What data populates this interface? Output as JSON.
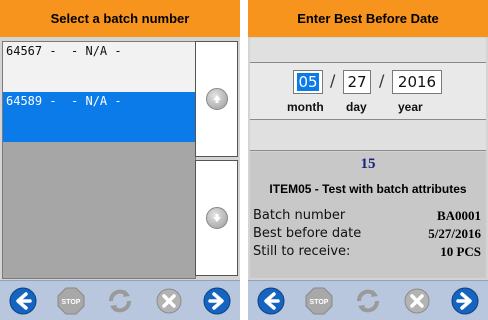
{
  "left_screen": {
    "title": "Select a batch number",
    "batches": [
      {
        "label": "64567 -  - N/A -",
        "selected": false
      },
      {
        "label": "64589 -  - N/A -",
        "selected": true
      }
    ],
    "scroll_up_icon": "arrow-up-icon",
    "scroll_down_icon": "arrow-down-icon"
  },
  "right_screen": {
    "title": "Enter Best Before Date",
    "date": {
      "month": "05",
      "day": "27",
      "year": "2016",
      "separator": "/",
      "month_label": "month",
      "day_label": "day",
      "year_label": "year"
    },
    "info": {
      "quantity": "15",
      "item": "ITEM05 - Test with batch attributes",
      "rows": [
        {
          "key": "Batch number",
          "value": "BA0001"
        },
        {
          "key": "Best before date",
          "value": "5/27/2016"
        },
        {
          "key": "Still to receive:",
          "value": "10 PCS"
        }
      ]
    }
  },
  "toolbar": {
    "back_icon": "back-arrow-icon",
    "stop_label": "STOP",
    "refresh_icon": "refresh-icon",
    "cancel_icon": "cancel-icon",
    "next_icon": "next-arrow-icon"
  },
  "colors": {
    "header": "#f7941d",
    "selection": "#0b7bea",
    "toolbar": "#b8c7de",
    "nav_blue": "#1565c0"
  }
}
